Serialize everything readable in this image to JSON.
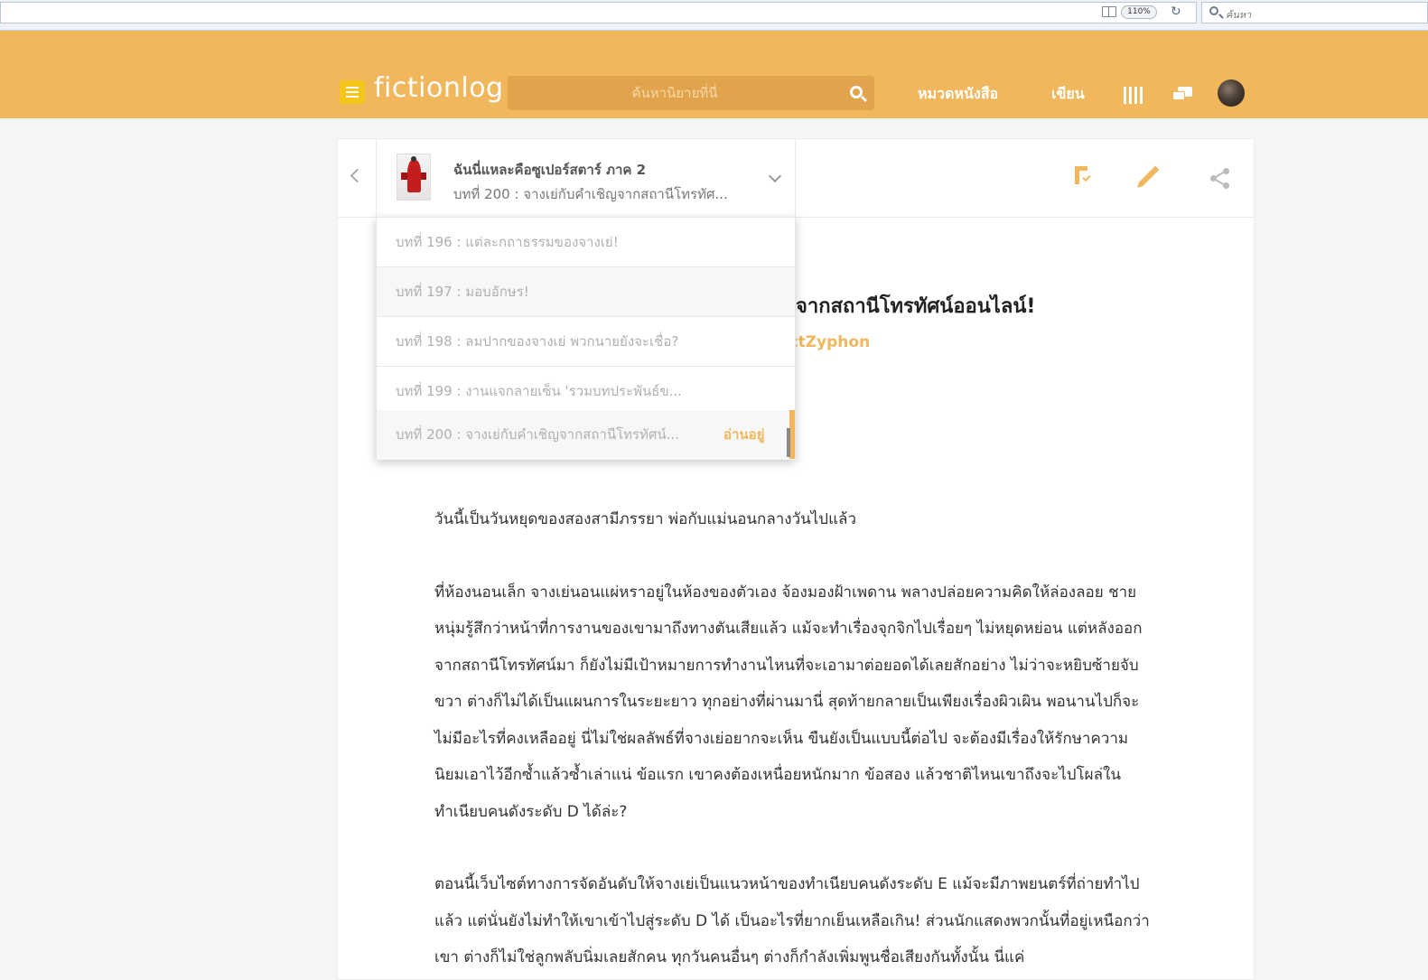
{
  "browser": {
    "zoom": "110%",
    "search_placeholder": "ค้นหา"
  },
  "header": {
    "logo": "fictionlog",
    "search_placeholder": "ค้นหานิยายที่นี่",
    "nav": {
      "categories": "หมวดหนังสือ",
      "write": "เขียน"
    },
    "accent_color": "#f0b75c"
  },
  "reader": {
    "book_title": "ฉันนี่แหละคือซูเปอร์สตาร์ ภาค 2",
    "current_chapter": "บทที่ 200 : จางเย่กับคำเชิญจากสถานีโทรทัศ...",
    "chapter_heading_visible": "จากสถานีโทรทัศน์ออนไลน์!",
    "author_visible": "ectZyphon",
    "chapters": [
      {
        "label": "บทที่ 196 : แต่ละกถาธรรมของจางเย่!"
      },
      {
        "label": "บทที่ 197 : มอบอักษร!"
      },
      {
        "label": "บทที่ 198 : ลมปากของจางเย่ พวกนายยังจะเชื่อ?"
      },
      {
        "label": "บทที่ 199 : งานแจกลายเซ็น 'รวมบทประพันธ์ข..."
      },
      {
        "label": "บทที่ 200 : จางเย่กับคำเชิญจากสถานีโทรทัศน์...",
        "badge": "อ่านอยู่"
      }
    ],
    "paragraphs": [
      "วันนี้เป็นวันหยุดของสองสามีภรรยา พ่อกับแม่นอนกลางวันไปแล้ว",
      "ที่ห้องนอนเล็ก จางเย่นอนแผ่หราอยู่ในห้องของตัวเอง จ้องมองฝ้าเพดาน พลางปล่อยความคิดให้ล่องลอย ชายหนุ่มรู้สึกว่าหน้าที่การงานของเขามาถึงทางตันเสียแล้ว แม้จะทำเรื่องจุกจิกไปเรื่อยๆ ไม่หยุดหย่อน แต่หลังออกจากสถานีโทรทัศน์มา ก็ยังไม่มีเป้าหมายการทำงานไหนที่จะเอามาต่อยอดได้เลยสักอย่าง ไม่ว่าจะหยิบซ้ายจับขวา ต่างก็ไม่ได้เป็นแผนการในระยะยาว ทุกอย่างที่ผ่านมานี่ สุดท้ายกลายเป็นเพียงเรื่องผิวเผิน พอนานไปก็จะไม่มีอะไรที่คงเหลืออยู่ นี่ไม่ใช่ผลลัพธ์ที่จางเย่อยากจะเห็น ขืนยังเป็นแบบนี้ต่อไป จะต้องมีเรื่องให้รักษาความนิยมเอาไว้อีกซ้ำแล้วซ้ำเล่าแน่ ข้อแรก เขาคงต้องเหนื่อยหนักมาก ข้อสอง แล้วชาติไหนเขาถึงจะไปโผล่ในทำเนียบคนดังระดับ D ได้ล่ะ?",
      "ตอนนี้เว็บไซต์ทางการจัดอันดับให้จางเย่เป็นแนวหน้าของทำเนียบคนดังระดับ E แม้จะมีภาพยนตร์ที่ถ่ายทำไปแล้ว แต่นั่นยังไม่ทำให้เขาเข้าไปสู่ระดับ D ได้ เป็นอะไรที่ยากเย็นเหลือเกิน! ส่วนนักแสดงพวกนั้นที่อยู่เหนือกว่าเขา ต่างก็ไม่ใช่ลูกพลับนิ่มเลยสักคน ทุกวันคนอื่นๆ ต่างก็กำลังเพิ่มพูนชื่อเสียงกันทั้งนั้น นี่แค่"
    ]
  }
}
